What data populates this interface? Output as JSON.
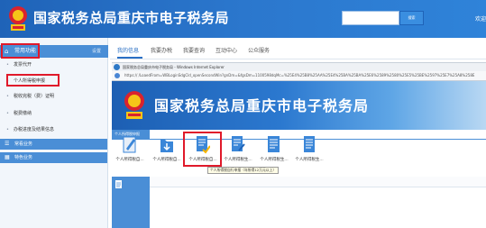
{
  "header": {
    "title": "国家税务总局重庆市电子税务局",
    "search_button": "搜索",
    "greeting": "欢迎"
  },
  "sidebar": {
    "head_label": "常用功能",
    "head_setting": "设置",
    "items": [
      {
        "label": "发票代开"
      },
      {
        "label": "个人所得税申报"
      },
      {
        "label": "税收完税（费）证明"
      },
      {
        "label": "税费缴纳"
      },
      {
        "label": "办税进度及结果信息"
      }
    ],
    "groups": [
      {
        "label": "常看业务"
      },
      {
        "label": "特色业务"
      }
    ]
  },
  "main_tabs": [
    "我的信息",
    "我要办税",
    "我要查询",
    "互动中心",
    "公众服务"
  ],
  "ie_window": {
    "title": "国家税务总局重庆市电子税务局 - Windows Internet Explorer",
    "url": "https://              /LoaedFrom=WBLoginSdgCld_openSecondWin?gnDm=&fgsDm=1100598dqMc=%25E4%25B8%25AA%25E4%25BA%25BA%25E6%2589%2580%25E5%25BE%2597%25E7%25A8%258E",
    "banner_title": "国家税务总局重庆市电子税务局"
  },
  "content": {
    "section_tab": "个人所得税申报",
    "services": [
      {
        "label": "个人所得税自..."
      },
      {
        "label": "个人所得税自..."
      },
      {
        "label": "个人所得税自..."
      },
      {
        "label": "个人所得税生..."
      },
      {
        "label": "个人所得税生..."
      },
      {
        "label": "个人所得税生..."
      }
    ],
    "tooltip": "个人所得税自行申报（年所得12万元以上）"
  },
  "colors": {
    "brand_blue": "#2b77cd",
    "sidebar_blue": "#4a8ed6",
    "highlight_red": "#e0192a"
  }
}
